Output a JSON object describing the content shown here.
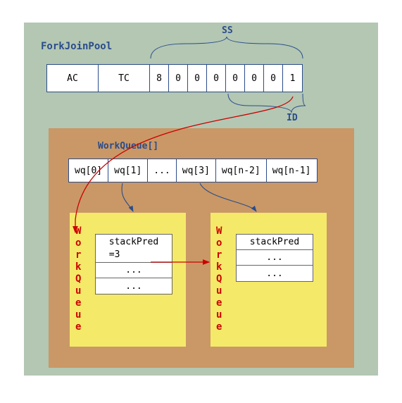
{
  "pool": {
    "title": "ForkJoinPool",
    "ssLabel": "SS",
    "idLabel": "ID",
    "ctl": {
      "ac": "AC",
      "tc": "TC",
      "digits": [
        "8",
        "0",
        "0",
        "0",
        "0",
        "0",
        "0",
        "1"
      ]
    }
  },
  "workQueues": {
    "arrayLabel": "WorkQueue[]",
    "slots": [
      "wq[0]",
      "wq[1]",
      "...",
      "wq[3]",
      "wq[n-2]",
      "wq[n-1]"
    ],
    "detail": [
      {
        "vertical": "WorkQueue",
        "rows": [
          "stackPred=3",
          "...",
          "..."
        ]
      },
      {
        "vertical": "WorkQueue",
        "rows": [
          "stackPred",
          "...",
          "..."
        ]
      }
    ]
  },
  "chart_data": {
    "type": "diagram",
    "description": "ForkJoinPool control word and WorkQueue array with stackPred linkage",
    "ctl_fields": {
      "AC": "?",
      "TC": "?",
      "SS_ID_hex": "80000001"
    },
    "workqueue_slots": [
      "wq[0]",
      "wq[1]",
      "...",
      "wq[3]",
      "wq[n-2]",
      "wq[n-1]"
    ],
    "arrows": [
      {
        "from": "ctl.ID",
        "to": "WorkQueue[wq[1]].stackPred",
        "color": "red"
      },
      {
        "from": "WorkQueue[wq[1]].stackPred=3",
        "to": "WorkQueue[wq[3]]",
        "color": "red"
      },
      {
        "from": "wq[1]",
        "to": "left-detail-box",
        "color": "black"
      },
      {
        "from": "wq[3]",
        "to": "right-detail-box",
        "color": "black"
      }
    ]
  }
}
